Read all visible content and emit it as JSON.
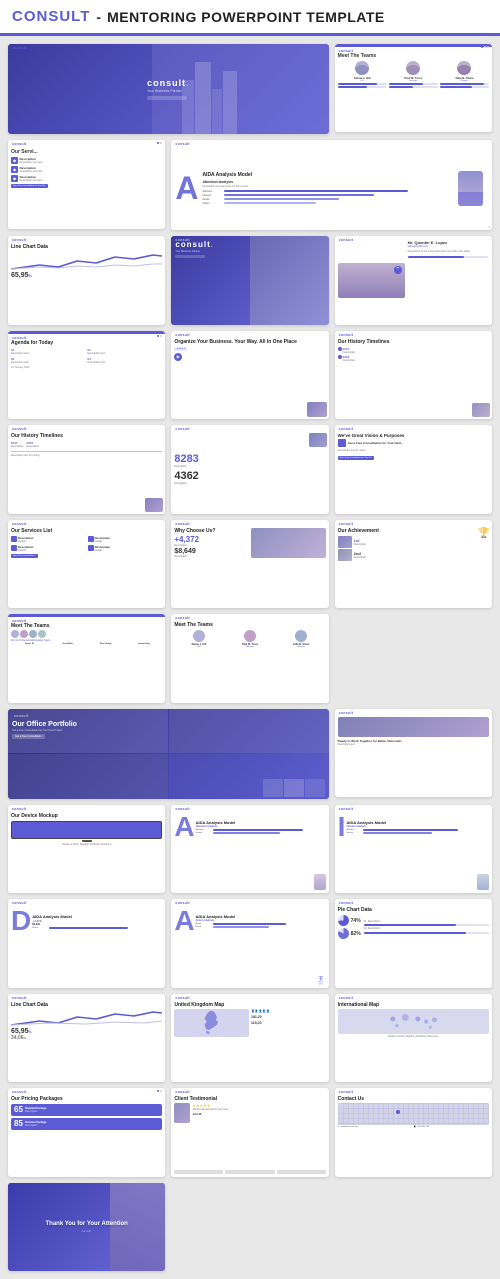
{
  "header": {
    "brand": "CONSULT",
    "separator": " - ",
    "title": "MENTORING POWERPOINT TEMPLATE"
  },
  "slides": [
    {
      "id": 1,
      "type": "hero",
      "label": "consult",
      "sub": "Your Business Partner",
      "tag": "consult."
    },
    {
      "id": 2,
      "type": "meet-teams",
      "title": "Meet The Teams",
      "members": [
        {
          "name": "Selina J. Gill",
          "role": "CEO"
        },
        {
          "name": "Paul M. Tores",
          "role": "Manager"
        },
        {
          "name": "Julia B. Stone",
          "role": "Designer"
        }
      ]
    },
    {
      "id": 3,
      "type": "services",
      "title": "Our Services",
      "cta": "Get a Free Consultation for Your Next Project"
    },
    {
      "id": 4,
      "type": "aida",
      "letter": "A",
      "title": "AIDA Analysis Model"
    },
    {
      "id": 5,
      "type": "line-chart",
      "title": "Line Chart Data",
      "value": "65,95%"
    },
    {
      "id": 6,
      "type": "hero2",
      "label": "consult.",
      "sub": ""
    },
    {
      "id": 7,
      "type": "quote",
      "name": "Mr. Quentin E. Lopez",
      "role": "Managing Director"
    },
    {
      "id": 8,
      "type": "agenda",
      "title": "Agenda for Today"
    },
    {
      "id": 9,
      "type": "organize",
      "title": "Organize Your Business. Your Way. All In One Place"
    },
    {
      "id": 10,
      "type": "history",
      "title": "Our History Timelines"
    },
    {
      "id": 11,
      "type": "history2",
      "title": "Our History Timelines"
    },
    {
      "id": 12,
      "type": "stats",
      "num1": "8283",
      "num2": "4362"
    },
    {
      "id": 13,
      "type": "vision",
      "title": "We've Great Vision & Purposes"
    },
    {
      "id": 14,
      "type": "services-list",
      "title": "Our Services List"
    },
    {
      "id": 15,
      "type": "why-choose",
      "title": "Why Choose Us?",
      "stat1": "+4,372",
      "stat2": "$8,649"
    },
    {
      "id": 16,
      "type": "achievement",
      "title": "Our Achievement",
      "place1": "1st",
      "place2": "2nd"
    },
    {
      "id": 17,
      "type": "meet2",
      "title": "Meet The Teams"
    },
    {
      "id": 18,
      "type": "meet3",
      "title": "Meet The Teams"
    },
    {
      "id": 19,
      "type": "portfolio",
      "title": "Our Office Portfolio"
    },
    {
      "id": 20,
      "type": "device-together",
      "text": "Ready to Work Together for Better Outcomes"
    },
    {
      "id": 21,
      "type": "device-mockup",
      "title": "Our Device Mockup"
    },
    {
      "id": 22,
      "type": "aida-a",
      "letter": "A",
      "title": "AIDA Analysis Model"
    },
    {
      "id": 23,
      "type": "aida-i",
      "letter": "I",
      "title": "AIDA Analysis Model"
    },
    {
      "id": 24,
      "type": "aida-d",
      "letter": "D",
      "title": "AIDA Analysis Model",
      "stat1": "+4,372",
      "stat2": "$8,649"
    },
    {
      "id": 25,
      "type": "aida-a2",
      "letter": "A",
      "title": "AIDA Analysis Model"
    },
    {
      "id": 26,
      "type": "pie",
      "title": "Pie Chart Data",
      "v1": "74%",
      "v2": "82%"
    },
    {
      "id": 27,
      "type": "line2",
      "title": "Line Chart Data",
      "v1": "65,95%",
      "v2": "34,06%"
    },
    {
      "id": 28,
      "type": "uk-map",
      "title": "United Kingdom Map",
      "stat1": "181,20",
      "stat2": "115,20"
    },
    {
      "id": 29,
      "type": "intl-map",
      "title": "International Map"
    },
    {
      "id": 30,
      "type": "pricing",
      "title": "Our Pricing Packages",
      "p1": "65",
      "p1-label": "Standard Package",
      "p2": "85",
      "p2-label": "Premium Package"
    },
    {
      "id": 31,
      "type": "testimonial",
      "title": "Client Testimonial"
    },
    {
      "id": 32,
      "type": "contact",
      "title": "Contact Us"
    },
    {
      "id": 33,
      "type": "thankyou",
      "text": "Thank You for Your Attention"
    }
  ]
}
